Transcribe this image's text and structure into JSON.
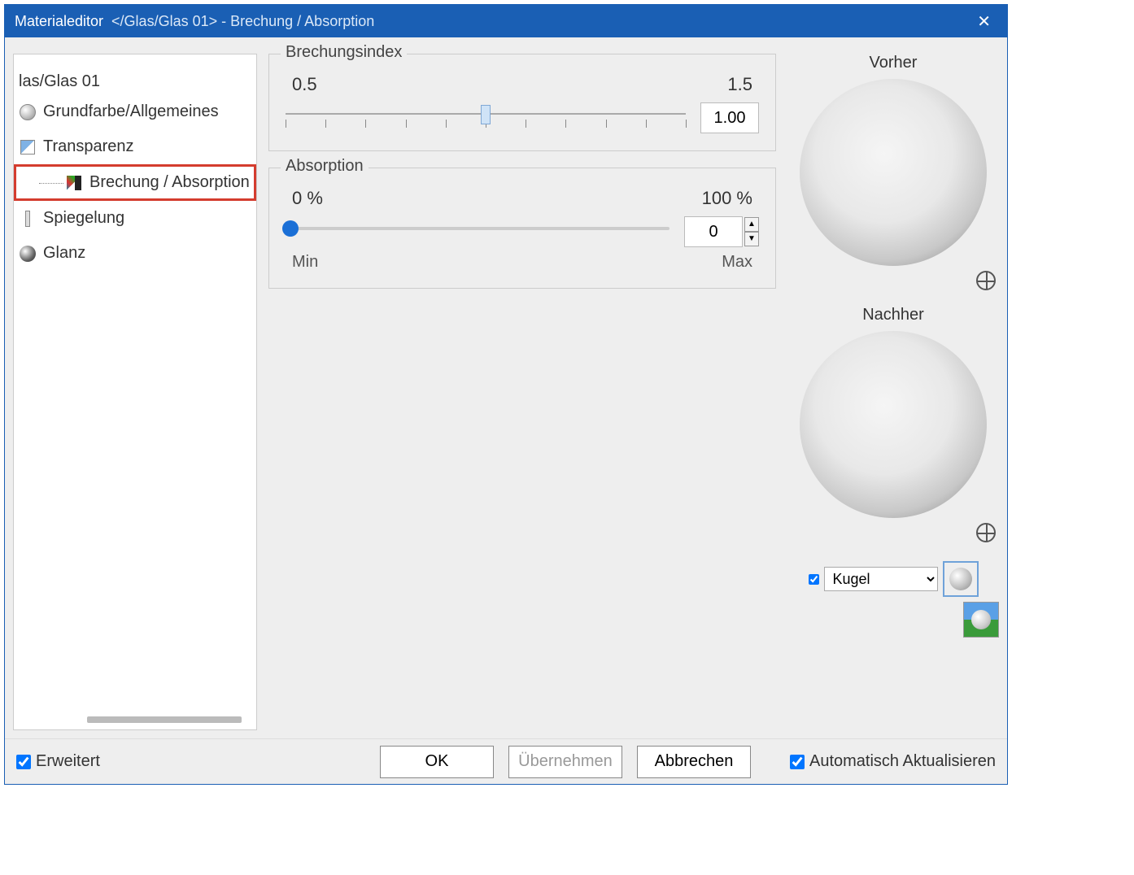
{
  "title": "Materialeditor",
  "title_path": "</Glas/Glas 01>  -  Brechung / Absorption",
  "tree": {
    "root": "las/Glas 01",
    "items": [
      "Grundfarbe/Allgemeines",
      "Transparenz",
      "Brechung / Absorption",
      "Spiegelung",
      "Glanz"
    ]
  },
  "refraction": {
    "legend": "Brechungsindex",
    "min_label": "0.5",
    "max_label": "1.5",
    "value": "1.00",
    "value_percent": 50
  },
  "absorption": {
    "legend": "Absorption",
    "min_label": "0 %",
    "max_label": "100 %",
    "min_text": "Min",
    "max_text": "Max",
    "value": "0",
    "value_percent": 0
  },
  "preview": {
    "before": "Vorher",
    "after": "Nachher",
    "shape_selected": "Kugel",
    "shape_checked": true
  },
  "footer": {
    "advanced": "Erweitert",
    "advanced_checked": true,
    "ok": "OK",
    "apply": "Übernehmen",
    "cancel": "Abbrechen",
    "auto": "Automatisch Aktualisieren",
    "auto_checked": true
  }
}
